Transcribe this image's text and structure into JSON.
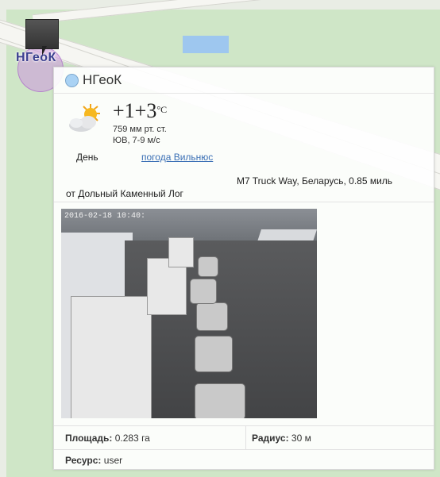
{
  "marker": {
    "label": "НГеоК",
    "icon": "camera-thumbnail-icon",
    "cursor_icon": "mouse-cursor-icon"
  },
  "popup": {
    "title": "НГеоК",
    "header_icon": "circle-marker-icon"
  },
  "weather": {
    "icon": "partly-cloudy-sun-icon",
    "temperature": "+1+3",
    "unit": "°C",
    "pressure": "759 мм рт. ст.",
    "wind": "ЮВ, 7-9 м/с",
    "day_label": "День",
    "link_text": "погода Вильнюс"
  },
  "location": {
    "road": "M7 Truck Way, Беларусь, 0.85 миль",
    "from": "от Дольный Каменный Лог"
  },
  "camera": {
    "timestamp": "2016-02-18 10:40:"
  },
  "details": {
    "area_label": "Площадь:",
    "area_value": "0.283 га",
    "radius_label": "Радиус:",
    "radius_value": "30 м",
    "resource_label": "Ресурс:",
    "resource_value": "user"
  },
  "colors": {
    "map_green": "#cfe6c7",
    "water": "#9ec7ef",
    "marker_circle": "#cc96dc",
    "link": "#3a6fb5"
  }
}
